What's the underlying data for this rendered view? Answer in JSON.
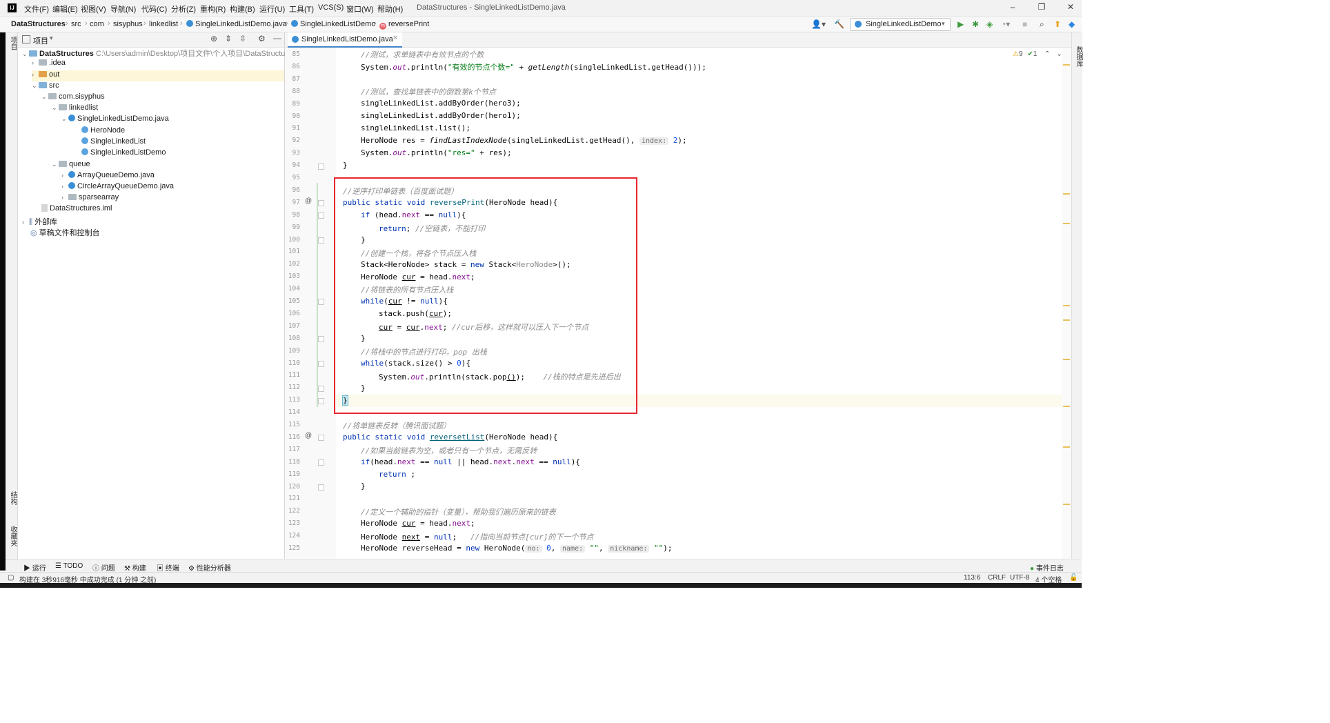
{
  "menu": {
    "logo": "IJ",
    "items": [
      "文件(F)",
      "编辑(E)",
      "视图(V)",
      "导航(N)",
      "代码(C)",
      "分析(Z)",
      "重构(R)",
      "构建(B)",
      "运行(U)",
      "工具(T)",
      "VCS(S)",
      "窗口(W)",
      "帮助(H)"
    ],
    "window_title": "DataStructures - SingleLinkedListDemo.java"
  },
  "breadcrumbs": [
    "DataStructures",
    "src",
    "com",
    "sisyphus",
    "linkedlist",
    "SingleLinkedListDemo.java",
    "SingleLinkedListDemo",
    "reversePrint"
  ],
  "run_config": "SingleLinkedListDemo",
  "project": {
    "header": "项目",
    "root_name": "DataStructures",
    "root_path": "C:\\Users\\admin\\Desktop\\项目文件\\个人项目\\DataStructures",
    "tree": [
      "DataStructures",
      ".idea",
      "out",
      "src",
      "com.sisyphus",
      "linkedlist",
      "SingleLinkedListDemo.java",
      "HeroNode",
      "SingleLinkedList",
      "SingleLinkedListDemo",
      "queue",
      "ArrayQueueDemo.java",
      "CircleArrayQueueDemo.java",
      "sparsearray",
      "DataStructures.iml",
      "外部库",
      "草稿文件和控制台"
    ]
  },
  "editor": {
    "tab_label": "SingleLinkedListDemo.java",
    "line_numbers": [
      "85",
      "86",
      "87",
      "88",
      "89",
      "90",
      "91",
      "92",
      "93",
      "94",
      "95",
      "96",
      "97",
      "98",
      "99",
      "100",
      "101",
      "102",
      "103",
      "104",
      "105",
      "106",
      "107",
      "108",
      "109",
      "110",
      "111",
      "112",
      "113",
      "114",
      "115",
      "116",
      "117",
      "118",
      "119",
      "120",
      "121",
      "122",
      "123",
      "124",
      "125"
    ],
    "code": {
      "c85": "//测试，求单链表中有效节点的个数",
      "c86a": "System.",
      "c86b": "out",
      "c86c": ".println(",
      "c86d": "\"有效的节点个数=\"",
      "c86e": " + ",
      "c86f": "getLength",
      "c86g": "(singleLinkedList.getHead()));",
      "c88": "//测试，查找单链表中的倒数第k个节点",
      "c89": "singleLinkedList.addByOrder(hero3);",
      "c90": "singleLinkedList.addByOrder(hero1);",
      "c91": "singleLinkedList.list();",
      "c92a": "HeroNode res = ",
      "c92b": "findLastIndexNode",
      "c92c": "(singleLinkedList.getHead(),",
      "c92hint": "index:",
      "c92d": " 2",
      "c92e": ");",
      "c93a": "System.",
      "c93b": "out",
      "c93c": ".println(",
      "c93d": "\"res=\"",
      "c93e": " + res);",
      "c94": "}",
      "c96": "//逆序打印单链表（百度面试题）",
      "c97a": "public static void ",
      "c97b": "reversePrint",
      "c97c": "(HeroNode head){",
      "c98a": "if",
      "c98b": " (head.",
      "c98c": "next",
      "c98d": " == ",
      "c98e": "null",
      "c98f": "){",
      "c99a": "return",
      "c99b": "; ",
      "c99c": "//空链表，不能打印",
      "c100": "}",
      "c101": "//创建一个栈，将各个节点压入栈",
      "c102a": "Stack<HeroNode> stack = ",
      "c102b": "new",
      "c102c": " Stack<",
      "c102d": "HeroNode",
      "c102e": ">();",
      "c103a": "HeroNode ",
      "c103b": "cur",
      "c103c": " = head.",
      "c103d": "next",
      "c103e": ";",
      "c104": "//将链表的所有节点压入栈",
      "c105a": "while",
      "c105b": "(",
      "c105c": "cur",
      "c105d": " != ",
      "c105e": "null",
      "c105f": "){",
      "c106a": "stack.push(",
      "c106b": "cur",
      "c106c": ");",
      "c107a": "cur",
      "c107b": " = ",
      "c107c": "cur",
      "c107d": ".",
      "c107e": "next",
      "c107f": "; ",
      "c107g": "//cur后移，这样就可以压入下一个节点",
      "c108": "}",
      "c109": "//将栈中的节点进行打印，pop 出栈",
      "c110a": "while",
      "c110b": "(stack.size() > ",
      "c110c": "0",
      "c110d": "){",
      "c111a": "System.",
      "c111b": "out",
      "c111c": ".println(stack.pop",
      "c111d": "()",
      "c111e": ");    ",
      "c111f": "//栈的特点是先进后出",
      "c112": "}",
      "c113": "}",
      "c115": "//将单链表反转（腾讯面试题）",
      "c116a": "public static void ",
      "c116b": "reversetList",
      "c116c": "(HeroNode head){",
      "c117": "//如果当前链表为空，或者只有一个节点，无需反转",
      "c118a": "if",
      "c118b": "(head.",
      "c118c": "next",
      "c118d": " == ",
      "c118e": "null",
      "c118f": " || head.",
      "c118g": "next",
      "c118h": ".",
      "c118i": "next",
      "c118j": " == ",
      "c118k": "null",
      "c118l": "){",
      "c119a": "return",
      "c119b": " ;",
      "c120": "}",
      "c122": "//定义一个辅助的指针（变量），帮助我们遍历原来的链表",
      "c123a": "HeroNode ",
      "c123b": "cur",
      "c123c": " = head.",
      "c123d": "next",
      "c123e": ";",
      "c124a": "HeroNode ",
      "c124b": "next",
      "c124c": " = ",
      "c124d": "null",
      "c124e": ";   ",
      "c124f": "//指向当前节点[cur]的下一个节点",
      "c125a": "HeroNode reverseHead = ",
      "c125b": "new",
      "c125c": " HeroNode(",
      "c125h1": "no:",
      "c125d": " 0",
      "c125e": ", ",
      "c125h2": "name:",
      "c125f": " \"\"",
      "c125g": ", ",
      "c125h3": "nickname:",
      "c125i": " \"\"",
      "c125j": ");"
    }
  },
  "inspections": {
    "warnings": "9",
    "ok": "1"
  },
  "bottom_tools": [
    "运行",
    "TODO",
    "问题",
    "构建",
    "终端",
    "性能分析器"
  ],
  "event_log": "事件日志",
  "status": {
    "message": "构建在 3秒916毫秒 中成功完成 (1 分钟 之前)",
    "position": "113:6",
    "line_sep": "CRLF",
    "encoding": "UTF-8",
    "indent": "4 个空格"
  },
  "left_tabs": [
    "项目",
    "结构",
    "收藏夹"
  ],
  "right_tabs": [
    "数据库"
  ]
}
